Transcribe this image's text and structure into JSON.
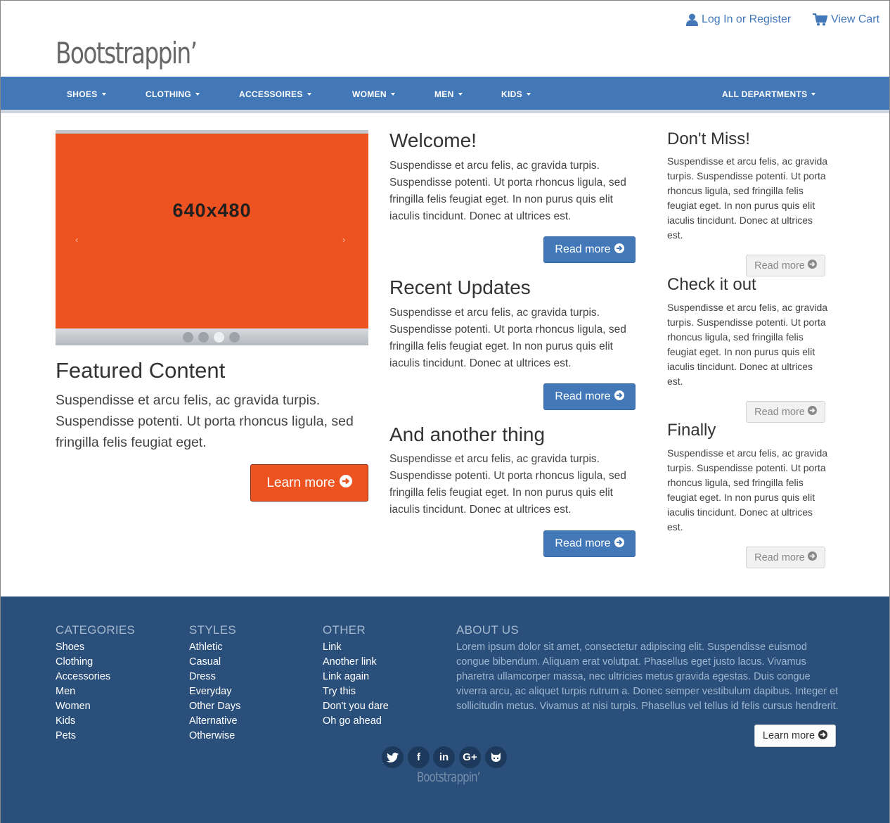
{
  "header": {
    "logo": "Bootstrappin’",
    "login_label": "Log In or Register",
    "cart_label": "View Cart"
  },
  "nav": {
    "items": [
      "SHOES",
      "CLOTHING",
      "ACCESSOIRES",
      "WOMEN",
      "MEN",
      "KIDS"
    ],
    "all_departments": "ALL DEPARTMENTS"
  },
  "carousel": {
    "slide_label": "640x480",
    "prev_icon": "chevron-left-icon",
    "next_icon": "chevron-right-icon",
    "dot_count": 4,
    "active_dot": 3,
    "slide_color": "#ec5320"
  },
  "featured": {
    "title": "Featured Content",
    "text": "Suspendisse et arcu felis, ac gravida turpis. Suspendisse potenti. Ut porta rhoncus ligula, sed fringilla felis feugiat eget.",
    "button_label": "Learn more"
  },
  "main_column": [
    {
      "title": "Welcome!",
      "text": "Suspendisse et arcu felis, ac gravida turpis. Suspendisse potenti. Ut porta rhoncus ligula, sed fringilla felis feugiat eget. In non purus quis elit iaculis tincidunt. Donec at ultrices est.",
      "button_label": "Read more"
    },
    {
      "title": "Recent Updates",
      "text": "Suspendisse et arcu felis, ac gravida turpis. Suspendisse potenti. Ut porta rhoncus ligula, sed fringilla felis feugiat eget. In non purus quis elit iaculis tincidunt. Donec at ultrices est.",
      "button_label": "Read more"
    },
    {
      "title": "And another thing",
      "text": "Suspendisse et arcu felis, ac gravida turpis. Suspendisse potenti. Ut porta rhoncus ligula, sed fringilla felis feugiat eget. In non purus quis elit iaculis tincidunt. Donec at ultrices est.",
      "button_label": "Read more"
    }
  ],
  "side_column": [
    {
      "title": "Don't Miss!",
      "text": "Suspendisse et arcu felis, ac gravida turpis. Suspendisse potenti. Ut porta rhoncus ligula, sed fringilla felis feugiat eget. In non purus quis elit iaculis tincidunt. Donec at ultrices est.",
      "button_label": "Read more"
    },
    {
      "title": "Check it out",
      "text": "Suspendisse et arcu felis, ac gravida turpis. Suspendisse potenti. Ut porta rhoncus ligula, sed fringilla felis feugiat eget. In non purus quis elit iaculis tincidunt. Donec at ultrices est.",
      "button_label": "Read more"
    },
    {
      "title": "Finally",
      "text": "Suspendisse et arcu felis, ac gravida turpis. Suspendisse potenti. Ut porta rhoncus ligula, sed fringilla felis feugiat eget. In non purus quis elit iaculis tincidunt. Donec at ultrices est.",
      "button_label": "Read more"
    }
  ],
  "footer": {
    "categories": {
      "heading": "CATEGORIES",
      "links": [
        "Shoes",
        "Clothing",
        "Accessories",
        "Men",
        "Women",
        "Kids",
        "Pets"
      ]
    },
    "styles": {
      "heading": "STYLES",
      "links": [
        "Athletic",
        "Casual",
        "Dress",
        "Everyday",
        "Other Days",
        "Alternative",
        "Otherwise"
      ]
    },
    "other": {
      "heading": "OTHER",
      "links": [
        "Link",
        "Another link",
        "Link again",
        "Try this",
        "Don't you dare",
        "Oh go ahead"
      ]
    },
    "about": {
      "heading": "ABOUT US",
      "text": "Lorem ipsum dolor sit amet, consectetur adipiscing elit. Suspendisse euismod congue bibendum. Aliquam erat volutpat. Phasellus eget justo lacus. Vivamus pharetra ullamcorper massa, nec ultricies metus gravida egestas. Duis congue viverra arcu, ac aliquet turpis rutrum a. Donec semper vestibulum dapibus. Integer et sollicitudin metus. Vivamus at nisi turpis. Phasellus vel tellus id felis cursus hendrerit.",
      "button_label": "Learn more"
    },
    "social_icons": [
      {
        "name": "twitter-icon",
        "glyph": "t"
      },
      {
        "name": "facebook-icon",
        "glyph": "f"
      },
      {
        "name": "linkedin-icon",
        "glyph": "in"
      },
      {
        "name": "google-plus-icon",
        "glyph": "G+"
      },
      {
        "name": "github-icon",
        "glyph": "gh"
      }
    ],
    "logo": "Bootstrappin’"
  },
  "colors": {
    "brand_blue": "#4278b8",
    "footer_blue": "#2a4f7a",
    "accent_orange": "#ec5320"
  }
}
